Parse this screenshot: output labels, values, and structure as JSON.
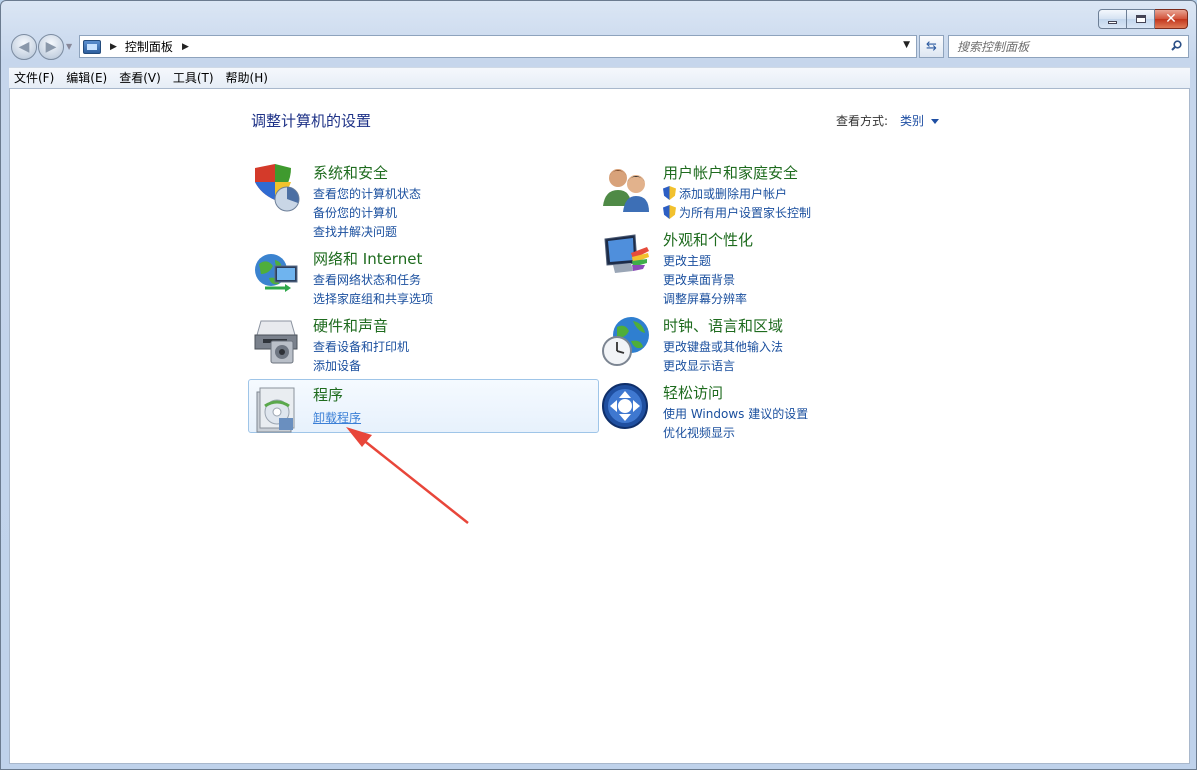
{
  "nav": {
    "breadcrumb": "控制面板",
    "search_placeholder": "搜索控制面板"
  },
  "menu": [
    {
      "label": "文件(F)"
    },
    {
      "label": "编辑(E)"
    },
    {
      "label": "查看(V)"
    },
    {
      "label": "工具(T)"
    },
    {
      "label": "帮助(H)"
    }
  ],
  "header": {
    "title": "调整计算机的设置",
    "view_label": "查看方式:",
    "view_value": "类别"
  },
  "categories": [
    {
      "title": "系统和安全",
      "icon": "system-security-icon",
      "links": [
        {
          "label": "查看您的计算机状态"
        },
        {
          "label": "备份您的计算机"
        },
        {
          "label": "查找并解决问题"
        }
      ]
    },
    {
      "title": "网络和 Internet",
      "icon": "network-icon",
      "links": [
        {
          "label": "查看网络状态和任务"
        },
        {
          "label": "选择家庭组和共享选项"
        }
      ]
    },
    {
      "title": "硬件和声音",
      "icon": "hardware-sound-icon",
      "links": [
        {
          "label": "查看设备和打印机"
        },
        {
          "label": "添加设备"
        }
      ]
    },
    {
      "title": "程序",
      "icon": "programs-icon",
      "links": [
        {
          "label": "卸载程序"
        }
      ]
    },
    {
      "title": "用户帐户和家庭安全",
      "icon": "user-accounts-icon",
      "links": [
        {
          "label": "添加或删除用户帐户"
        },
        {
          "label": "为所有用户设置家长控制"
        }
      ]
    },
    {
      "title": "外观和个性化",
      "icon": "appearance-icon",
      "links": [
        {
          "label": "更改主题"
        },
        {
          "label": "更改桌面背景"
        },
        {
          "label": "调整屏幕分辨率"
        }
      ]
    },
    {
      "title": "时钟、语言和区域",
      "icon": "clock-region-icon",
      "links": [
        {
          "label": "更改键盘或其他输入法"
        },
        {
          "label": "更改显示语言"
        }
      ]
    },
    {
      "title": "轻松访问",
      "icon": "ease-of-access-icon",
      "links": [
        {
          "label": "使用 Windows 建议的设置"
        },
        {
          "label": "优化视频显示"
        }
      ]
    }
  ],
  "colors": {
    "category_title": "#1e6b1e",
    "link": "#1a4f9e",
    "annotation_arrow": "#e8463a"
  }
}
